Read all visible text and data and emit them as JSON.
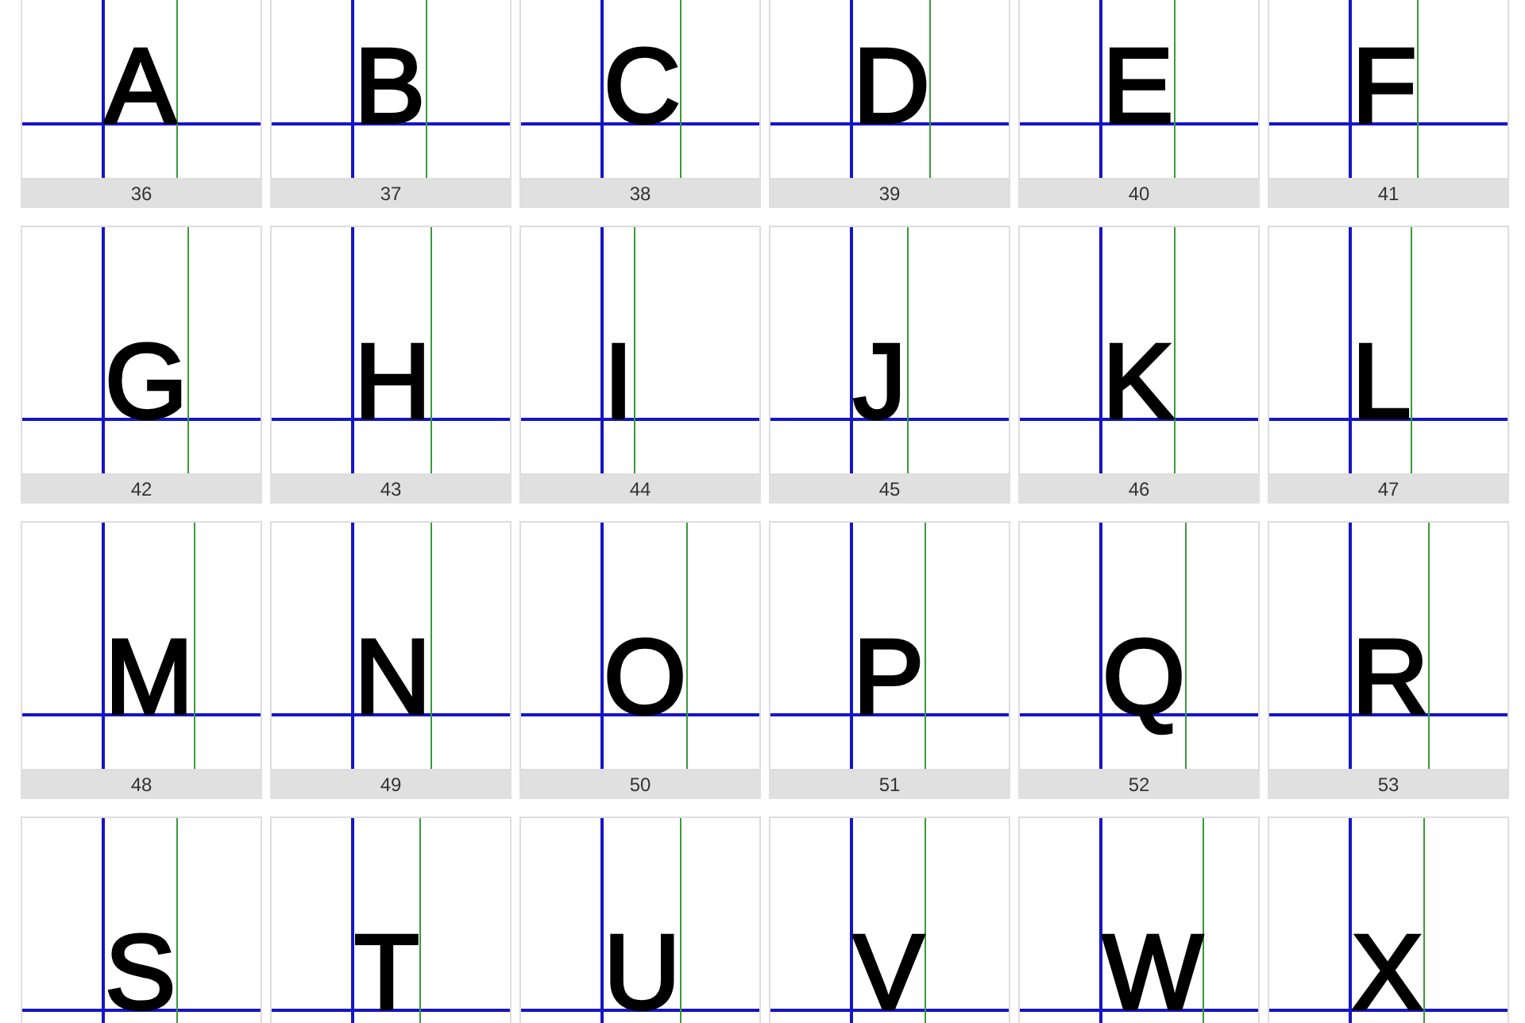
{
  "glyphs": [
    {
      "char": "A",
      "index": "36"
    },
    {
      "char": "B",
      "index": "37"
    },
    {
      "char": "C",
      "index": "38"
    },
    {
      "char": "D",
      "index": "39"
    },
    {
      "char": "E",
      "index": "40"
    },
    {
      "char": "F",
      "index": "41"
    },
    {
      "char": "G",
      "index": "42"
    },
    {
      "char": "H",
      "index": "43"
    },
    {
      "char": "I",
      "index": "44"
    },
    {
      "char": "J",
      "index": "45"
    },
    {
      "char": "K",
      "index": "46"
    },
    {
      "char": "L",
      "index": "47"
    },
    {
      "char": "M",
      "index": "48"
    },
    {
      "char": "N",
      "index": "49"
    },
    {
      "char": "O",
      "index": "50"
    },
    {
      "char": "P",
      "index": "51"
    },
    {
      "char": "Q",
      "index": "52"
    },
    {
      "char": "R",
      "index": "53"
    },
    {
      "char": "S"
    },
    {
      "char": "T"
    },
    {
      "char": "U"
    },
    {
      "char": "V"
    },
    {
      "char": "W"
    },
    {
      "char": "X"
    }
  ]
}
